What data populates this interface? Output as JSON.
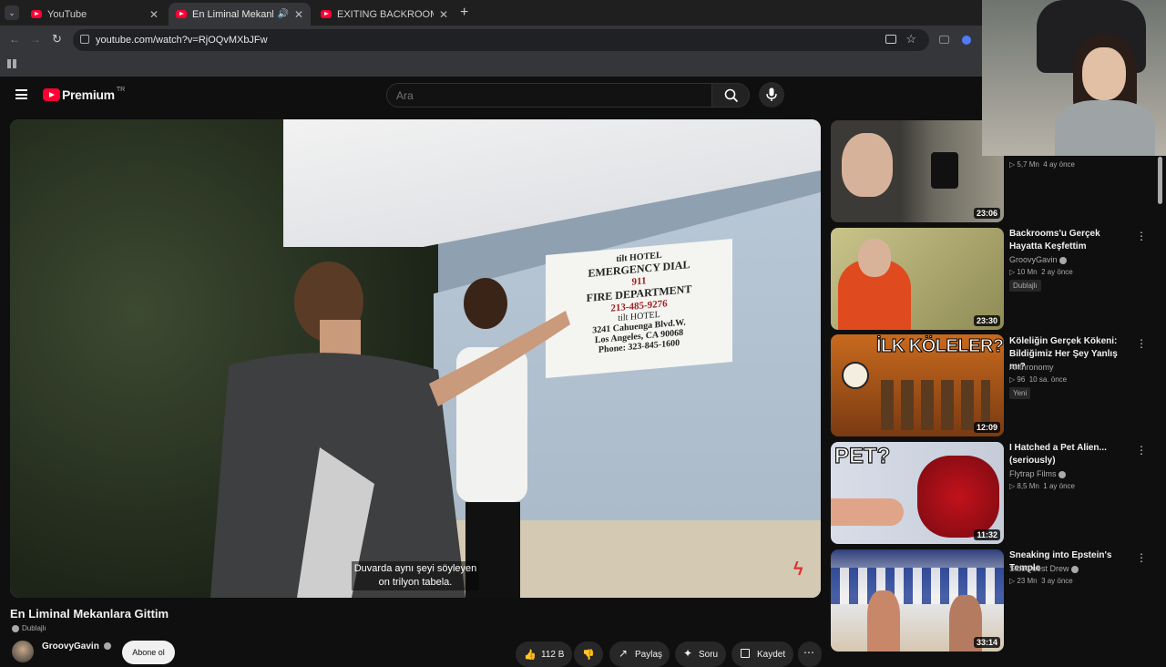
{
  "browser": {
    "tabs": [
      {
        "title": "YouTube",
        "active": false
      },
      {
        "title": "En Liminal Mekanlara Gittim",
        "active": true
      },
      {
        "title": "EXITING BACKROOMS: THE END",
        "active": false
      }
    ],
    "url": "youtube.com/watch?v=RjOQvMXbJFw"
  },
  "header": {
    "logo_text": "Premium",
    "region": "TR",
    "search_placeholder": "Ara"
  },
  "video": {
    "subtitle_line1": "Duvarda aynı şeyi söyleyen",
    "subtitle_line2": "on trilyon tabela.",
    "sign_lines": [
      "tilt HOTEL",
      "EMERGENCY DIAL",
      "911",
      "FIRE DEPARTMENT",
      "213-485-9276",
      "tilt HOTEL",
      "3241 Cahuenga Blvd.W.",
      "Los Angeles, CA 90068",
      "Phone: 323-845-1600"
    ]
  },
  "meta": {
    "title": "En Liminal Mekanlara Gittim",
    "dubbed": "Dublajlı",
    "channel": "GroovyGavin",
    "subscribe": "Abone ol",
    "likes": "112 B",
    "share": "Paylaş",
    "ask": "Soru",
    "save": "Kaydet"
  },
  "recommendations": [
    {
      "title": "",
      "channel": "",
      "views": "5,7 Mn",
      "age": "4 ay önce",
      "duration": "23:06",
      "badge": ""
    },
    {
      "title": "Backrooms'u Gerçek Hayatta Keşfettim",
      "channel": "GroovyGavin",
      "views": "10 Mn",
      "age": "2 ay önce",
      "duration": "23:30",
      "badge": "Dublajlı"
    },
    {
      "title": "Köleliğin Gerçek Kökeni: Bildiğimiz Her Şey Yanlış mı?",
      "channel": "Anthronomy",
      "views": "96",
      "age": "10 sa. önce",
      "duration": "12:09",
      "badge": "Yeni",
      "thumb_text": "İLK KÖLELER?"
    },
    {
      "title": "I Hatched a Pet Alien... (seriously)",
      "channel": "Flytrap Films",
      "views": "8,5 Mn",
      "age": "1 ay önce",
      "duration": "11:32",
      "badge": "",
      "thumb_text": "PET?"
    },
    {
      "title": "Sneaking into Epstein's Temple",
      "channel": "SideQuest Drew",
      "views": "23 Mn",
      "age": "3 ay önce",
      "duration": "33:14",
      "badge": ""
    }
  ],
  "colors": {
    "brand": "#ff0033",
    "bg": "#0f0f0f",
    "surface": "#272727"
  }
}
